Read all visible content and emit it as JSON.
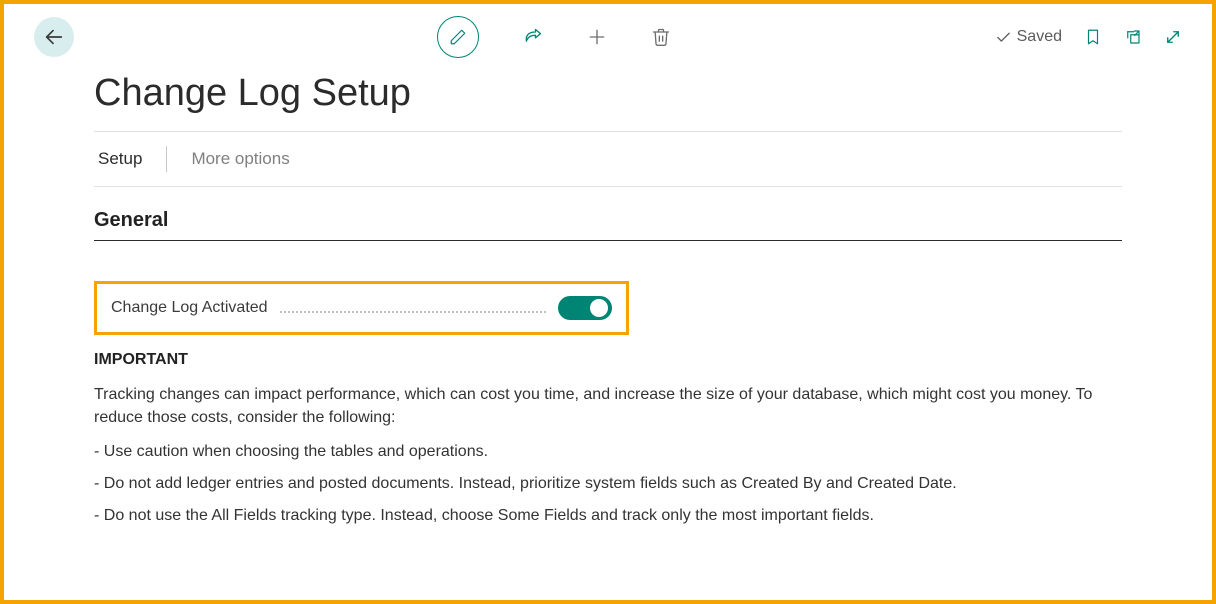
{
  "header": {
    "saved_label": "Saved"
  },
  "page": {
    "title": "Change Log Setup"
  },
  "tabs": {
    "setup": "Setup",
    "more_options": "More options"
  },
  "section": {
    "general": "General"
  },
  "fields": {
    "change_log_activated_label": "Change Log Activated",
    "change_log_activated_value": true
  },
  "notice": {
    "important_heading": "IMPORTANT",
    "intro": "Tracking changes can impact performance, which can cost you time, and increase the size of your database, which might cost you money. To reduce those costs, consider the following:",
    "bullets": [
      "- Use caution when choosing the tables and operations.",
      "- Do not add ledger entries and posted documents. Instead, prioritize system fields such as Created By and Created Date.",
      "- Do not use the All Fields tracking type. Instead, choose Some Fields and track only the most important fields."
    ]
  },
  "colors": {
    "accent_teal": "#008575",
    "highlight_orange": "#f5a300"
  }
}
